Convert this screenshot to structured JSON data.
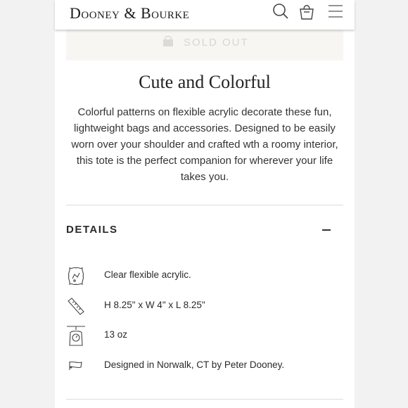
{
  "header": {
    "logo": "Dooney & Bourke",
    "icons": [
      "search-icon",
      "shopping-bag-icon",
      "menu-icon"
    ]
  },
  "soldout": {
    "label": "SOLD OUT",
    "icon": "lock-icon"
  },
  "product": {
    "headline": "Cute and Colorful",
    "description": "Colorful patterns on flexible acrylic decorate these fun, lightweight bags and accessories. Designed to be easily worn over your shoulder and crafted wth a roomy interior, this tote is the perfect companion for wherever your life takes you."
  },
  "details": {
    "title": "DETAILS",
    "toggle_icon": "minus-icon",
    "items": [
      {
        "icon": "leather-hide-icon",
        "text": "Clear flexible acrylic."
      },
      {
        "icon": "ruler-icon",
        "text": "H 8.25\" x W 4\" x L 8.25\""
      },
      {
        "icon": "scale-icon",
        "text": "13 oz"
      },
      {
        "icon": "pennant-flag-icon",
        "text": "Designed in Norwalk, CT by Peter Dooney."
      }
    ]
  },
  "colors": {
    "soldout_bg": "#f7f6f3",
    "soldout_text": "#d8d6d2",
    "divider": "#dcdcdc"
  }
}
